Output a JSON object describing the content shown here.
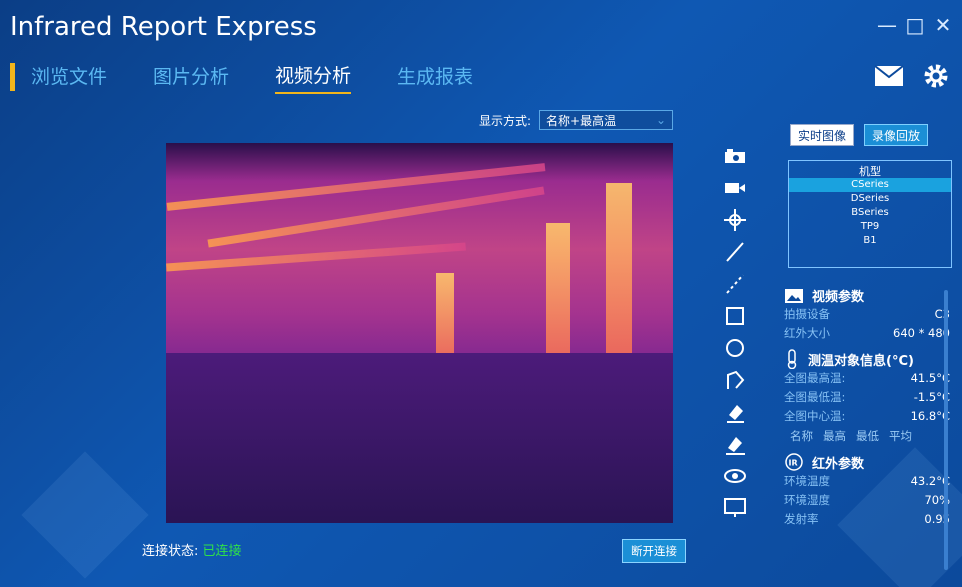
{
  "app": {
    "title": "Infrared Report Express"
  },
  "nav": {
    "tabs": [
      {
        "label": "浏览文件"
      },
      {
        "label": "图片分析"
      },
      {
        "label": "视频分析"
      },
      {
        "label": "生成报表"
      }
    ],
    "active": 2
  },
  "display_mode": {
    "label": "显示方式:",
    "value": "名称+最高温"
  },
  "mode_buttons": {
    "live": "实时图像",
    "playback": "录像回放"
  },
  "model_list": {
    "header": "机型",
    "items": [
      "CSeries",
      "DSeries",
      "BSeries",
      "TP9",
      "B1"
    ],
    "selected": "CSeries"
  },
  "video_params": {
    "title": "视频参数",
    "rows": [
      {
        "k": "拍摄设备",
        "v": "C3"
      },
      {
        "k": "红外大小",
        "v": "640 * 480"
      }
    ]
  },
  "temp_info": {
    "title": "测温对象信息(°C)",
    "rows": [
      {
        "k": "全图最高温:",
        "v": "41.5°C"
      },
      {
        "k": "全图最低温:",
        "v": "-1.5°C"
      },
      {
        "k": "全图中心温:",
        "v": "16.8°C"
      }
    ],
    "columns": [
      "名称",
      "最高",
      "最低",
      "平均"
    ]
  },
  "ir_params": {
    "title": "红外参数",
    "rows": [
      {
        "k": "环境温度",
        "v": "43.2°C"
      },
      {
        "k": "环境湿度",
        "v": "70%"
      },
      {
        "k": "发射率",
        "v": "0.95"
      }
    ]
  },
  "status": {
    "label": "连接状态:",
    "value": "已连接"
  },
  "disconnect_button": "断开连接",
  "colors": {
    "accent": "#f1b51c",
    "inactive_tab": "#5bb8f2",
    "connected": "#2fe04a"
  }
}
